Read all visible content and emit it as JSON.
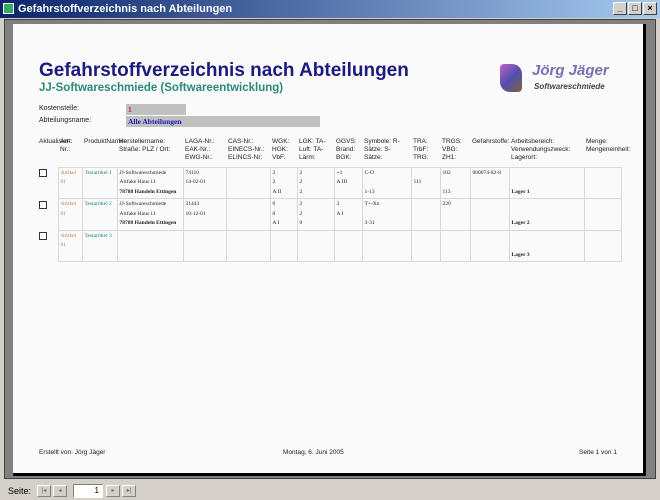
{
  "window": {
    "title": "Gefahrstoffverzeichnis nach Abteilungen",
    "minimize": "_",
    "maximize": "□",
    "close": "×"
  },
  "report": {
    "title": "Gefahrstoffverzeichnis nach Abteilungen",
    "subtitle": "JJ-Softwareschmiede (Softwareentwicklung)",
    "logo": {
      "name": "Jörg Jäger",
      "tagline": "Softwareschmiede"
    },
    "kostenstelle_label": "Kostenstelle:",
    "kostenstelle_value": "1",
    "abteilung_label": "Abteilungsname:",
    "abteilung_value": "Alle Abteilungen",
    "headers": [
      "Aktualisiert:",
      "Art-Nr.:",
      "ProduktName:",
      "Herstellername: Straße: PLZ / Ort:",
      "LAGA-Nr.: EAK-Nr.: EWG-Nr.:",
      "CAS-Nr.: EINECS-Nr.: ELINCS-Nr:",
      "WGK: HGK: VbF:",
      "LGK: TA-Luft: TA-Lärm:",
      "GGVS: Brand: BGK:",
      "Symbole: R-Sätze: S-Sätze:",
      "TRA: TrbF: TRG:",
      "TRGS: VBG: ZH1:",
      "Gefahrstoffe:",
      "Arbeitsbereich: Verwendungszweck: Lagerort:",
      "Menge: Mengeneinheit:"
    ],
    "rows": [
      {
        "art": "Artikel 01",
        "prod": "Testartikel 1",
        "herst": [
          "JJ-Softwareschmiede",
          "Artfake Haus 11",
          "78788 Handeln Ettingen"
        ],
        "laga": [
          "74110",
          "14-02-01",
          ""
        ],
        "cas": [
          "",
          "",
          ""
        ],
        "wgk": [
          "2",
          "2",
          "A II"
        ],
        "lgk": [
          "2",
          "2",
          "2"
        ],
        "ggvs": [
          "+1",
          "A III",
          ""
        ],
        "sym": [
          "C-O",
          "",
          "1-13"
        ],
        "tra": [
          "",
          "111",
          ""
        ],
        "trgs": [
          "102",
          "",
          "113"
        ],
        "gef": "000074-82-8",
        "arb": [
          "",
          "",
          "Lager 1"
        ],
        "menge": ""
      },
      {
        "art": "Artikel 01",
        "prod": "Testartikel 2",
        "herst": [
          "JJ-Softwareschmiede",
          "Artfake Haus 11",
          "78788 Handeln Ettingen"
        ],
        "laga": [
          "31443",
          "10-12-01",
          ""
        ],
        "cas": [
          "",
          "",
          ""
        ],
        "wgk": [
          "0",
          "0",
          "A I"
        ],
        "lgk": [
          "2",
          "2",
          "0"
        ],
        "ggvs": [
          "3",
          "A I",
          ""
        ],
        "sym": [
          "T+-Xn",
          "",
          "3-31"
        ],
        "tra": [
          "",
          "",
          ""
        ],
        "trgs": [
          "220",
          "",
          ""
        ],
        "gef": "",
        "arb": [
          "",
          "",
          "Lager 2"
        ],
        "menge": ""
      },
      {
        "art": "Artikel 01",
        "prod": "Testartikel 3",
        "herst": [
          "",
          "",
          ""
        ],
        "laga": [
          "",
          "",
          ""
        ],
        "cas": [
          "",
          "",
          ""
        ],
        "wgk": [
          "",
          "",
          ""
        ],
        "lgk": [
          "",
          "",
          ""
        ],
        "ggvs": [
          "",
          "",
          ""
        ],
        "sym": [
          "",
          "",
          ""
        ],
        "tra": [
          "",
          "",
          ""
        ],
        "trgs": [
          "",
          "",
          ""
        ],
        "gef": "",
        "arb": [
          "",
          "",
          "Lager 3"
        ],
        "menge": ""
      }
    ],
    "footer": {
      "author": "Erstellt von: Jörg Jäger",
      "date": "Montag, 6. Juni 2005",
      "page": "Seite 1 von 1"
    }
  },
  "statusbar": {
    "label": "Seite:",
    "page": "1",
    "first": "|◂",
    "prev": "◂",
    "next": "▸",
    "last": "▸|"
  }
}
